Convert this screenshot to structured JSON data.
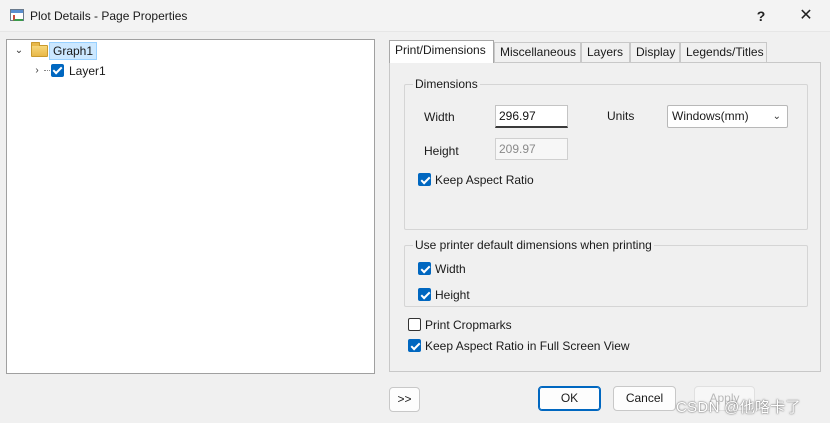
{
  "window": {
    "title": "Plot Details - Page Properties",
    "help": "?",
    "close": "✕"
  },
  "tree": {
    "root": {
      "label": "Graph1",
      "expander": "⌄"
    },
    "child": {
      "label": "Layer1",
      "expander": "›",
      "checked": true
    }
  },
  "tabs": [
    "Print/Dimensions",
    "Miscellaneous",
    "Layers",
    "Display",
    "Legends/Titles"
  ],
  "active_tab": "Print/Dimensions",
  "dimensions": {
    "group_title": "Dimensions",
    "width_label": "Width",
    "width_value": "296.97",
    "height_label": "Height",
    "height_value": "209.97",
    "units_label": "Units",
    "units_value": "Windows(mm)",
    "keep_aspect_label": "Keep Aspect Ratio",
    "keep_aspect_checked": true
  },
  "printer": {
    "group_title": "Use printer default dimensions when printing",
    "width_label": "Width",
    "width_checked": true,
    "height_label": "Height",
    "height_checked": true
  },
  "options": {
    "cropmarks_label": "Print Cropmarks",
    "cropmarks_checked": false,
    "fullscreen_label": "Keep Aspect Ratio in Full Screen View",
    "fullscreen_checked": true
  },
  "buttons": {
    "expand": ">>",
    "ok": "OK",
    "cancel": "Cancel",
    "apply": "Apply"
  },
  "watermark": "CSDN @他咯卡了",
  "colors": {
    "accent": "#0067c0",
    "selection": "#cce8ff"
  }
}
